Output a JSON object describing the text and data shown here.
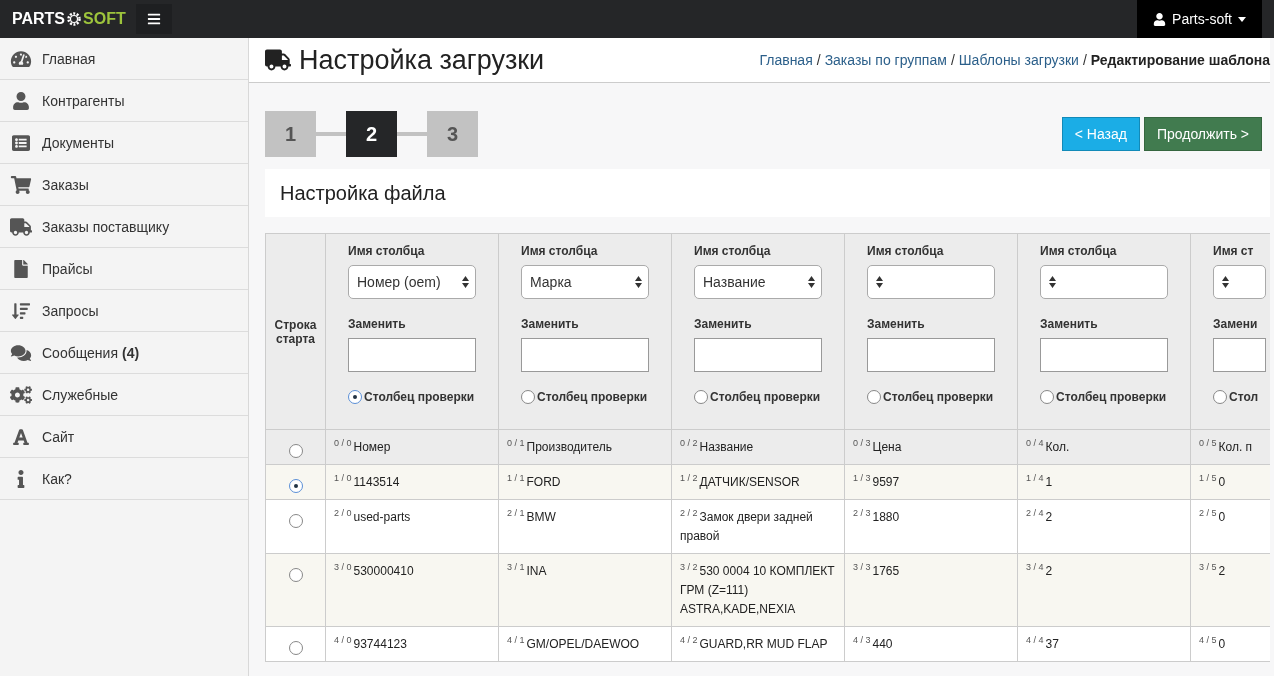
{
  "topbar": {
    "logo_left": "PARTS",
    "logo_right": "SOFT",
    "user": "Parts-soft"
  },
  "sidebar": {
    "items": [
      {
        "label": "Главная",
        "selected": false
      },
      {
        "label": "Контрагенты",
        "selected": false
      },
      {
        "label": "Документы",
        "selected": false
      },
      {
        "label": "Заказы",
        "selected": false
      },
      {
        "label": "Заказы поставщику",
        "selected": false
      },
      {
        "label": "Прайсы",
        "selected": false
      },
      {
        "label": "Запросы",
        "selected": false
      },
      {
        "label": "Сообщения",
        "badge": "(4)",
        "selected": false
      },
      {
        "label": "Служебные",
        "selected": false
      },
      {
        "label": "Сайт",
        "selected": false
      },
      {
        "label": "Как?",
        "selected": false
      }
    ]
  },
  "page": {
    "title": "Настройка загрузки",
    "breadcrumb_separator": "/",
    "breadcrumb": [
      {
        "label": "Главная",
        "current": false
      },
      {
        "label": "Заказы по группам",
        "current": false
      },
      {
        "label": "Шаблоны загрузки",
        "current": false
      },
      {
        "label": "Редактирование шаблона",
        "current": true
      }
    ],
    "steps": [
      {
        "label": "1",
        "selected": false
      },
      {
        "label": "2",
        "selected": true
      },
      {
        "label": "3",
        "selected": false
      }
    ],
    "buttons": [
      {
        "label": "< Назад",
        "kind": "back"
      },
      {
        "label": "Продолжить >",
        "kind": "next"
      }
    ],
    "section_title": "Настройка файла"
  },
  "table": {
    "start_label": "Строка старта",
    "columns": [
      {
        "name_label": "Имя столбца",
        "name_value": "Номер (oem)",
        "replace_label": "Заменить",
        "check_label": "Столбец проверки",
        "check_selected": true
      },
      {
        "name_label": "Имя столбца",
        "name_value": "Марка",
        "replace_label": "Заменить",
        "check_label": "Столбец проверки",
        "check_selected": false
      },
      {
        "name_label": "Имя столбца",
        "name_value": "Название",
        "replace_label": "Заменить",
        "check_label": "Столбец проверки",
        "check_selected": false
      },
      {
        "name_label": "Имя столбца",
        "replace_label": "Заменить",
        "check_label": "Столбец проверки",
        "check_selected": false
      },
      {
        "name_label": "Имя столбца",
        "replace_label": "Заменить",
        "check_label": "Столбец проверки",
        "check_selected": false
      },
      {
        "name_label": "Имя ст",
        "replace_label": "Замени",
        "check_label": "Стол",
        "check_selected": false
      }
    ],
    "rows": [
      {
        "selected": false,
        "cells": [
          {
            "index": "0 / 0",
            "value": "Номер"
          },
          {
            "index": "0 / 1",
            "value": "Производитель"
          },
          {
            "index": "0 / 2",
            "value": "Название"
          },
          {
            "index": "0 / 3",
            "value": "Цена"
          },
          {
            "index": "0 / 4",
            "value": "Кол."
          },
          {
            "index": "0 / 5",
            "value": "Кол. п"
          }
        ]
      },
      {
        "selected": true,
        "cells": [
          {
            "index": "1 / 0",
            "value": "1143514"
          },
          {
            "index": "1 / 1",
            "value": "FORD"
          },
          {
            "index": "1 / 2",
            "value": "ДАТЧИК/SENSOR"
          },
          {
            "index": "1 / 3",
            "value": "9597"
          },
          {
            "index": "1 / 4",
            "value": "1"
          },
          {
            "index": "1 / 5",
            "value": "0"
          }
        ]
      },
      {
        "selected": false,
        "cells": [
          {
            "index": "2 / 0",
            "value": "used-parts"
          },
          {
            "index": "2 / 1",
            "value": "BMW"
          },
          {
            "index": "2 / 2",
            "value": "Замок двери задней правой"
          },
          {
            "index": "2 / 3",
            "value": "1880"
          },
          {
            "index": "2 / 4",
            "value": "2"
          },
          {
            "index": "2 / 5",
            "value": "0"
          }
        ]
      },
      {
        "selected": false,
        "cells": [
          {
            "index": "3 / 0",
            "value": "530000410"
          },
          {
            "index": "3 / 1",
            "value": "INA"
          },
          {
            "index": "3 / 2",
            "value": "530 0004 10 КОМПЛЕКТ ГРМ (Z=111) ASTRA,KADE,NEXIA"
          },
          {
            "index": "3 / 3",
            "value": "1765"
          },
          {
            "index": "3 / 4",
            "value": "2"
          },
          {
            "index": "3 / 5",
            "value": "2"
          }
        ]
      },
      {
        "selected": false,
        "cells": [
          {
            "index": "4 / 0",
            "value": "93744123"
          },
          {
            "index": "4 / 1",
            "value": "GM/OPEL/DAEWOO"
          },
          {
            "index": "4 / 2",
            "value": "GUARD,RR MUD FLAP"
          },
          {
            "index": "4 / 3",
            "value": "440"
          },
          {
            "index": "4 / 4",
            "value": "37"
          },
          {
            "index": "4 / 5",
            "value": "0"
          }
        ]
      }
    ]
  }
}
